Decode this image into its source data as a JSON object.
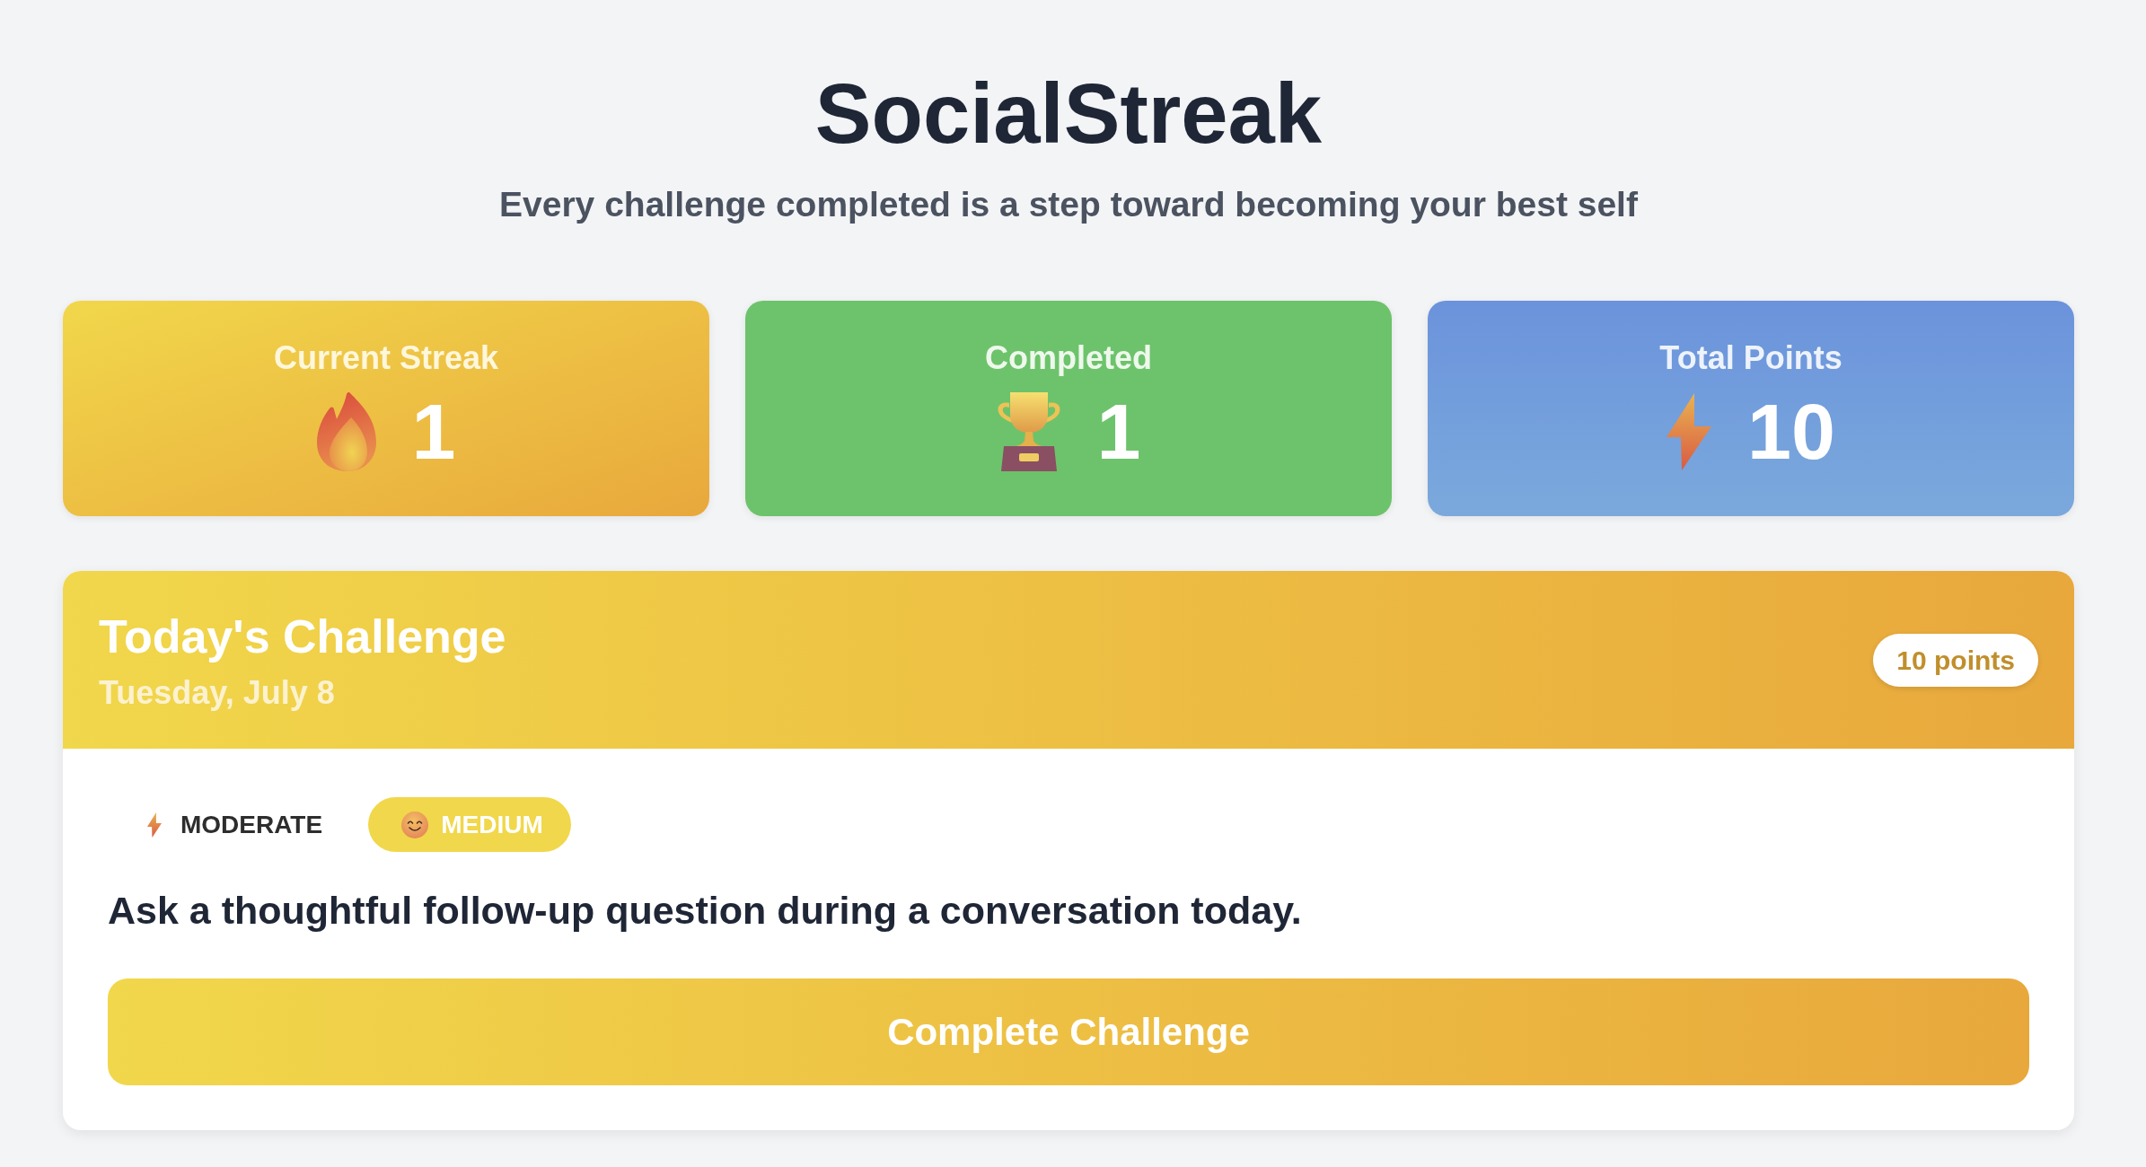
{
  "header": {
    "title": "SocialStreak",
    "subtitle": "Every challenge completed is a step toward becoming your best self"
  },
  "stats": [
    {
      "kind": "streak",
      "label": "Current Streak",
      "value": "1"
    },
    {
      "kind": "completed",
      "label": "Completed",
      "value": "1"
    },
    {
      "kind": "points",
      "label": "Total Points",
      "value": "10"
    }
  ],
  "challenge": {
    "title": "Today's Challenge",
    "date": "Tuesday, July 8",
    "points": "10 points",
    "tags": [
      {
        "kind": "category",
        "label": "MODERATE"
      },
      {
        "kind": "difficulty",
        "label": "MEDIUM"
      }
    ],
    "description": "Ask a thoughtful follow-up question during a conversation today.",
    "button": "Complete Challenge"
  }
}
